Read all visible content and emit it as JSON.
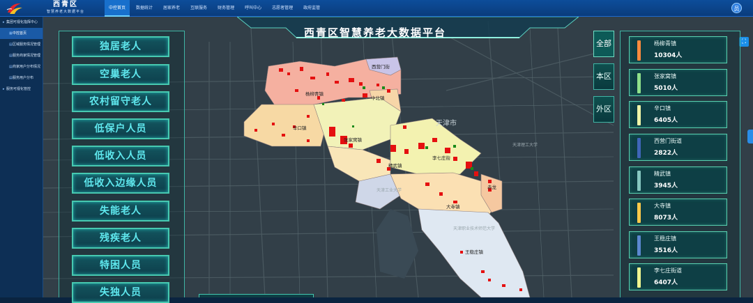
{
  "brand": {
    "title": "西青区",
    "subtitle": "智慧养老大数据平台"
  },
  "nav": [
    {
      "label": "中控首页",
      "active": true
    },
    {
      "label": "数据统计"
    },
    {
      "label": "居家养老"
    },
    {
      "label": "互联服务"
    },
    {
      "label": "财务管理"
    },
    {
      "label": "呼叫中心"
    },
    {
      "label": "志愿者管理"
    },
    {
      "label": "政府监管"
    }
  ],
  "user": {
    "avatar_text": "员"
  },
  "sidebar": [
    {
      "label": "集团可视化指挥中心",
      "icon": "triangle-icon",
      "level": 0
    },
    {
      "label": "中控首页",
      "icon": "grid-icon",
      "level": 1,
      "active": true
    },
    {
      "label": "区域服务情况管理",
      "icon": "doc-icon",
      "level": 1
    },
    {
      "label": "服务商家情况管理",
      "icon": "doc-icon",
      "level": 1
    },
    {
      "label": "商家用户分布情况",
      "icon": "doc-icon",
      "level": 1
    },
    {
      "label": "服务用户分布",
      "icon": "doc-icon",
      "level": 1
    },
    {
      "label": "服务可视化管控",
      "icon": "triangle-icon",
      "level": 0
    }
  ],
  "platform_title": "西青区智慧养老大数据平台",
  "categories": [
    "独居老人",
    "空巢老人",
    "农村留守老人",
    "低保户人员",
    "低收入人员",
    "低收入边缘人员",
    "失能老人",
    "残疾老人",
    "特困人员",
    "失独人员"
  ],
  "region_tabs": [
    {
      "label": "全部",
      "active": true
    },
    {
      "label": "本区"
    },
    {
      "label": "外区"
    }
  ],
  "towns": [
    {
      "name": "杨柳青镇",
      "count": "10304人",
      "color": "#ff8a3d"
    },
    {
      "name": "张家窝镇",
      "count": "5010人",
      "color": "#8fe08a"
    },
    {
      "name": "辛口镇",
      "count": "6405人",
      "color": "#f0f5a8"
    },
    {
      "name": "西营门街道",
      "count": "2822人",
      "color": "#3f66b8"
    },
    {
      "name": "精武镇",
      "count": "3945人",
      "color": "#86c7c0"
    },
    {
      "name": "大寺镇",
      "count": "8073人",
      "color": "#ffc94a"
    },
    {
      "name": "王稳庄镇",
      "count": "3516人",
      "color": "#5b88d0"
    },
    {
      "name": "李七庄街道",
      "count": "6407人",
      "color": "#eef58f"
    }
  ],
  "map": {
    "region_labels": [
      "西营门街",
      "杨柳青镇",
      "中北镇",
      "辛口镇",
      "张家窝镇",
      "精武镇",
      "李七庄街",
      "大寺镇",
      "王稳庄镇",
      "赤龙"
    ],
    "base_labels": [
      "天津市",
      "天津工业大学",
      "天津理工大学",
      "天津职业技术师范大学"
    ]
  },
  "icons": {
    "logo": "logo-icon",
    "fullscreen": "fullscreen-icon"
  }
}
